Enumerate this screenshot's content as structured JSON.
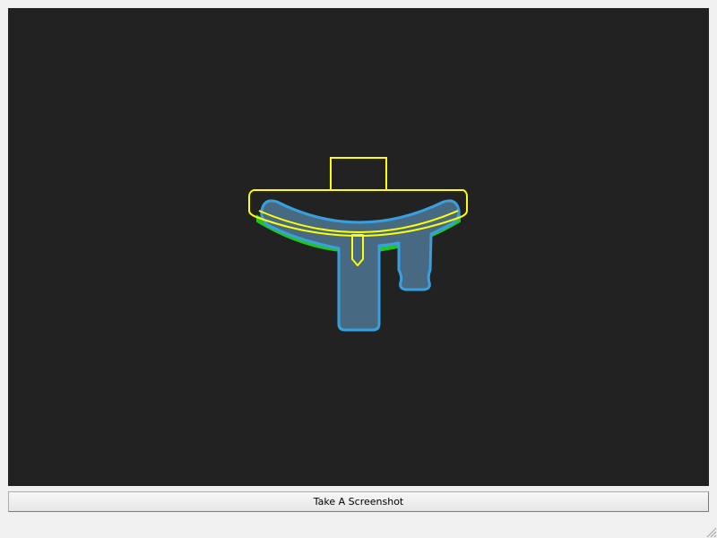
{
  "button": {
    "label": "Take A Screenshot"
  },
  "scene": {
    "background_color": "#222222",
    "outline_colors": {
      "yellow": "#ffff00",
      "blue": "#39a0e0",
      "green": "#22c422",
      "fill": "#476a82"
    }
  }
}
